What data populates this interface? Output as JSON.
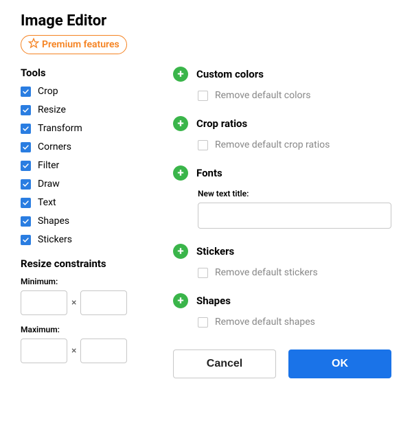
{
  "title": "Image Editor",
  "premium_label": "Premium features",
  "tools": {
    "heading": "Tools",
    "items": [
      {
        "label": "Crop",
        "checked": true
      },
      {
        "label": "Resize",
        "checked": true
      },
      {
        "label": "Transform",
        "checked": true
      },
      {
        "label": "Corners",
        "checked": true
      },
      {
        "label": "Filter",
        "checked": true
      },
      {
        "label": "Draw",
        "checked": true
      },
      {
        "label": "Text",
        "checked": true
      },
      {
        "label": "Shapes",
        "checked": true
      },
      {
        "label": "Stickers",
        "checked": true
      }
    ]
  },
  "resize_constraints": {
    "heading": "Resize constraints",
    "min_label": "Minimum:",
    "max_label": "Maximum:",
    "times_symbol": "×",
    "min_w": "",
    "min_h": "",
    "max_w": "",
    "max_h": ""
  },
  "custom_colors": {
    "heading": "Custom colors",
    "remove_default_label": "Remove default colors",
    "remove_default_checked": false
  },
  "crop_ratios": {
    "heading": "Crop ratios",
    "remove_default_label": "Remove default crop ratios",
    "remove_default_checked": false
  },
  "fonts": {
    "heading": "Fonts",
    "new_text_title_label": "New text title:",
    "new_text_title_value": ""
  },
  "stickers": {
    "heading": "Stickers",
    "remove_default_label": "Remove default stickers",
    "remove_default_checked": false
  },
  "shapes": {
    "heading": "Shapes",
    "remove_default_label": "Remove default shapes",
    "remove_default_checked": false
  },
  "buttons": {
    "cancel": "Cancel",
    "ok": "OK"
  }
}
